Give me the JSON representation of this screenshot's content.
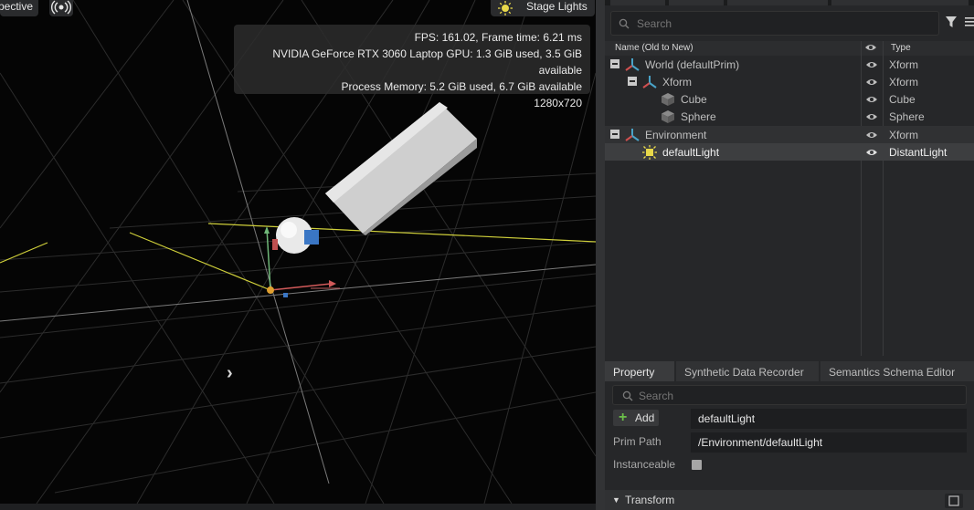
{
  "viewport": {
    "camera_label": "Perspective",
    "stage_lights_label": "Stage Lights",
    "stats": [
      "FPS: 161.02, Frame time: 6.21 ms",
      "NVIDIA GeForce RTX 3060 Laptop GPU: 1.3 GiB used, 3.5 GiB available",
      "Process Memory: 5.2 GiB used, 6.7 GiB available",
      "1280x720"
    ]
  },
  "stage": {
    "search_placeholder": "Search",
    "columns": {
      "name": "Name (Old to New)",
      "type": "Type"
    },
    "rows": [
      {
        "name": "World (defaultPrim)",
        "type": "Xform"
      },
      {
        "name": "Xform",
        "type": "Xform"
      },
      {
        "name": "Cube",
        "type": "Cube"
      },
      {
        "name": "Sphere",
        "type": "Sphere"
      },
      {
        "name": "Environment",
        "type": "Xform"
      },
      {
        "name": "defaultLight",
        "type": "DistantLight"
      }
    ]
  },
  "property": {
    "tabs": [
      "Property",
      "Synthetic Data Recorder",
      "Semantics Schema Editor"
    ],
    "search_placeholder": "Search",
    "add_label": "Add",
    "prim_name": "defaultLight",
    "prim_path_label": "Prim Path",
    "prim_path": "/Environment/defaultLight",
    "instanceable_label": "Instanceable",
    "transform_label": "Transform"
  },
  "colors": {
    "accent_selection": "#3d3e40",
    "light_icon": "#e8d84a",
    "xform_icon": "#4aa3c8",
    "add_plus": "#6cc04a"
  }
}
